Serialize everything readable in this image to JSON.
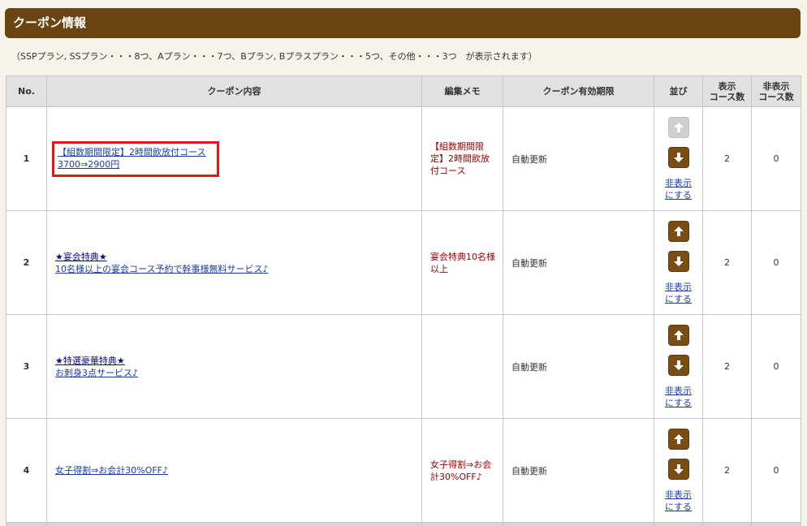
{
  "title": "クーポン情報",
  "note": "（SSPプラン, SSプラン・・・8つ、Aプラン・・・7つ、Bプラン, Bプラスプラン・・・5つ、その他・・・3つ　が表示されます）",
  "columns": {
    "no": "No.",
    "content": "クーポン内容",
    "memo": "編集メモ",
    "period": "クーポン有効期限",
    "order": "並び",
    "shown": [
      "表示",
      "コース数"
    ],
    "hidden": [
      "非表示",
      "コース数"
    ]
  },
  "hide_label": [
    "非表示",
    "にする"
  ],
  "rows": [
    {
      "no": "1",
      "content": [
        "【組数期間限定】2時間飲放付コース",
        "3700⇒2900円"
      ],
      "memo": "【組数期間限定】2時間飲放付コース",
      "period": "自動更新",
      "shown": "2",
      "hidden": "0",
      "up_disabled": true,
      "highlighted": true
    },
    {
      "no": "2",
      "content": [
        "★宴会特典★",
        "10名様以上の宴会コース予約で幹事様無料サービス♪"
      ],
      "memo": "宴会特典10名様以上",
      "period": "自動更新",
      "shown": "2",
      "hidden": "0",
      "up_disabled": false,
      "highlighted": false
    },
    {
      "no": "3",
      "content": [
        "★特選豪華特典★",
        "お刺身3点サービス♪"
      ],
      "memo": "",
      "period": "自動更新",
      "shown": "2",
      "hidden": "0",
      "up_disabled": false,
      "highlighted": false
    },
    {
      "no": "4",
      "content": [
        "女子得割⇒お会計30%OFF♪"
      ],
      "memo": "女子得割⇒お会計30%OFF♪",
      "period": "自動更新",
      "shown": "2",
      "hidden": "0",
      "up_disabled": false,
      "highlighted": false
    }
  ],
  "icons": {
    "up": "arrow-up-icon",
    "down": "arrow-down-icon"
  },
  "colors": {
    "title_bar": "#6b4511",
    "arrow_button": "#7a4d14",
    "highlight_border": "#e01717",
    "memo_text": "#990000",
    "link": "#1a3da6"
  }
}
